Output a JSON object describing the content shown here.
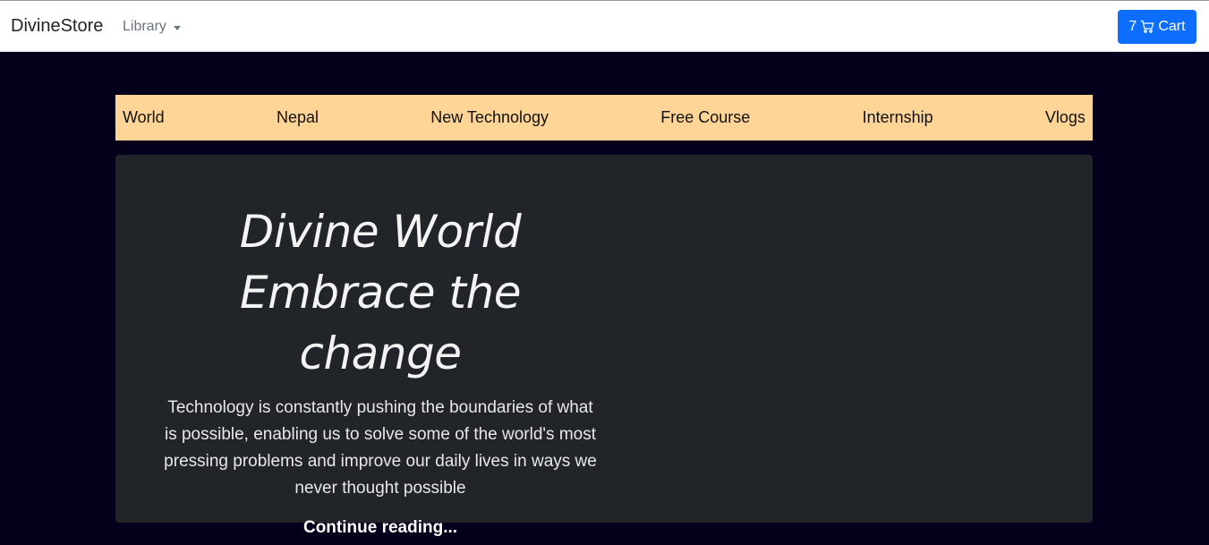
{
  "navbar": {
    "brand": "DivineStore",
    "library_label": "Library",
    "cart_count": "7",
    "cart_label": "Cart"
  },
  "categories": [
    "World",
    "Nepal",
    "New Technology",
    "Free Course",
    "Internship",
    "Vlogs"
  ],
  "hero": {
    "title_line1": "Divine World",
    "title_line2": "Embrace the change",
    "text": "Technology is constantly pushing the boundaries of what is possible, enabling us to solve some of the world's most pressing problems and improve our daily lives in ways we never thought possible",
    "link": "Continue reading..."
  },
  "icons": {
    "cart": "cart-icon",
    "dropdown": "chevron-down-icon"
  },
  "colors": {
    "page_bg": "#04001c",
    "navbar_bg": "#ffffff",
    "category_bar_bg": "#fed597",
    "hero_bg": "#212529",
    "button_primary": "#0d6efd"
  }
}
